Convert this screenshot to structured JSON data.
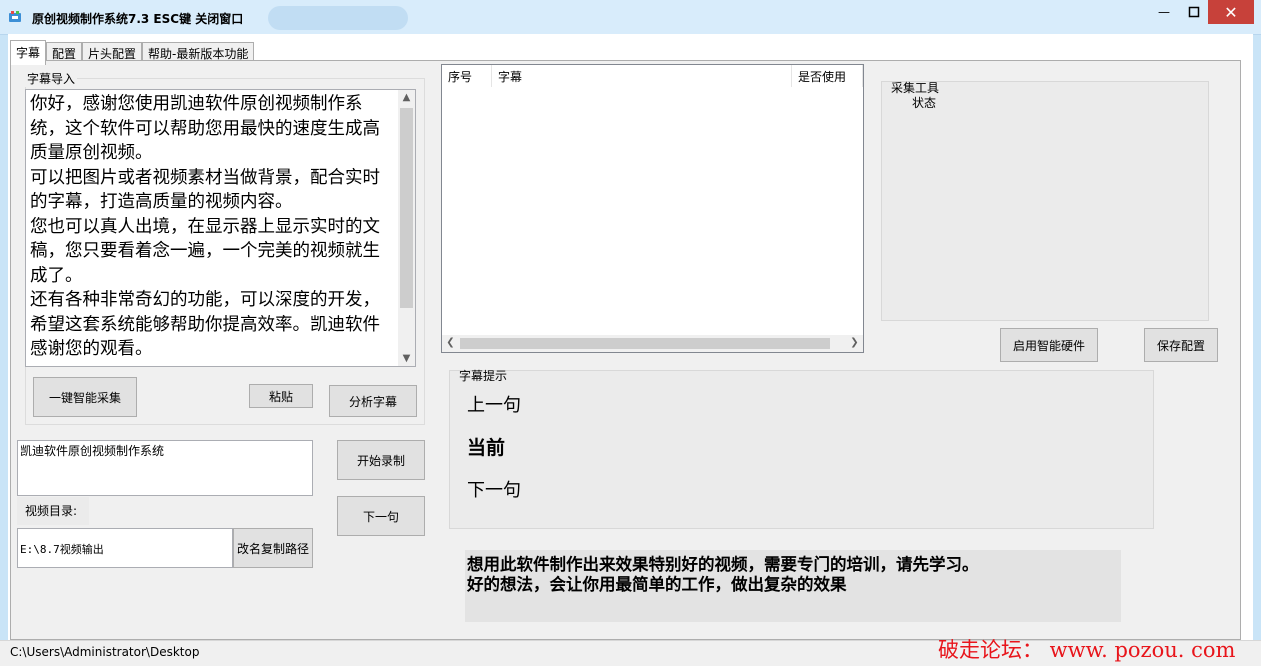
{
  "window": {
    "title": "原创视频制作系统7.3    ESC键 关闭窗口",
    "buttons": {
      "minimize": "—",
      "maximize": "□",
      "close": "✕"
    }
  },
  "tabs": [
    {
      "label": "字幕"
    },
    {
      "label": "配置"
    },
    {
      "label": "片头配置"
    },
    {
      "label": "帮助-最新版本功能"
    }
  ],
  "subtitle_import": {
    "group_label": "字幕导入",
    "text": "你好，感谢您使用凯迪软件原创视频制作系统，这个软件可以帮助您用最快的速度生成高质量原创视频。\n可以把图片或者视频素材当做背景，配合实时的字幕，打造高质量的视频内容。\n您也可以真人出境，在显示器上显示实时的文稿，您只要看着念一遍，一个完美的视频就生成了。\n还有各种非常奇幻的功能，可以深度的开发，希望这套系统能够帮助你提高效率。凯迪软件感谢您的观看。",
    "smart_collect_button": "一键智能采集",
    "paste_button": "粘贴",
    "analyze_button": "分析字幕"
  },
  "recording": {
    "title_value": "凯迪软件原创视频制作系统",
    "start_button": "开始录制",
    "next_button": "下一句",
    "dir_label": "视频目录:",
    "dir_value": "E:\\8.7视频输出",
    "rename_button": "改名复制路径"
  },
  "subtitle_list": {
    "columns": [
      "序号",
      "字幕",
      "是否使用"
    ],
    "rows": []
  },
  "collect_tool": {
    "group_label": "采集工具",
    "status_label": "状态",
    "enable_hw_button": "启用智能硬件",
    "save_config_button": "保存配置"
  },
  "subtitle_hint": {
    "group_label": "字幕提示",
    "prev": "上一句",
    "current": "当前",
    "next": "下一句"
  },
  "notice": {
    "line1": "想用此软件制作出来效果特别好的视频，需要专门的培训，请先学习。",
    "line2": "好的想法，会让你用最简单的工作，做出复杂的效果"
  },
  "status_bar": {
    "path": "C:\\Users\\Administrator\\Desktop"
  },
  "watermark": "破走论坛： www. pozou. com"
}
